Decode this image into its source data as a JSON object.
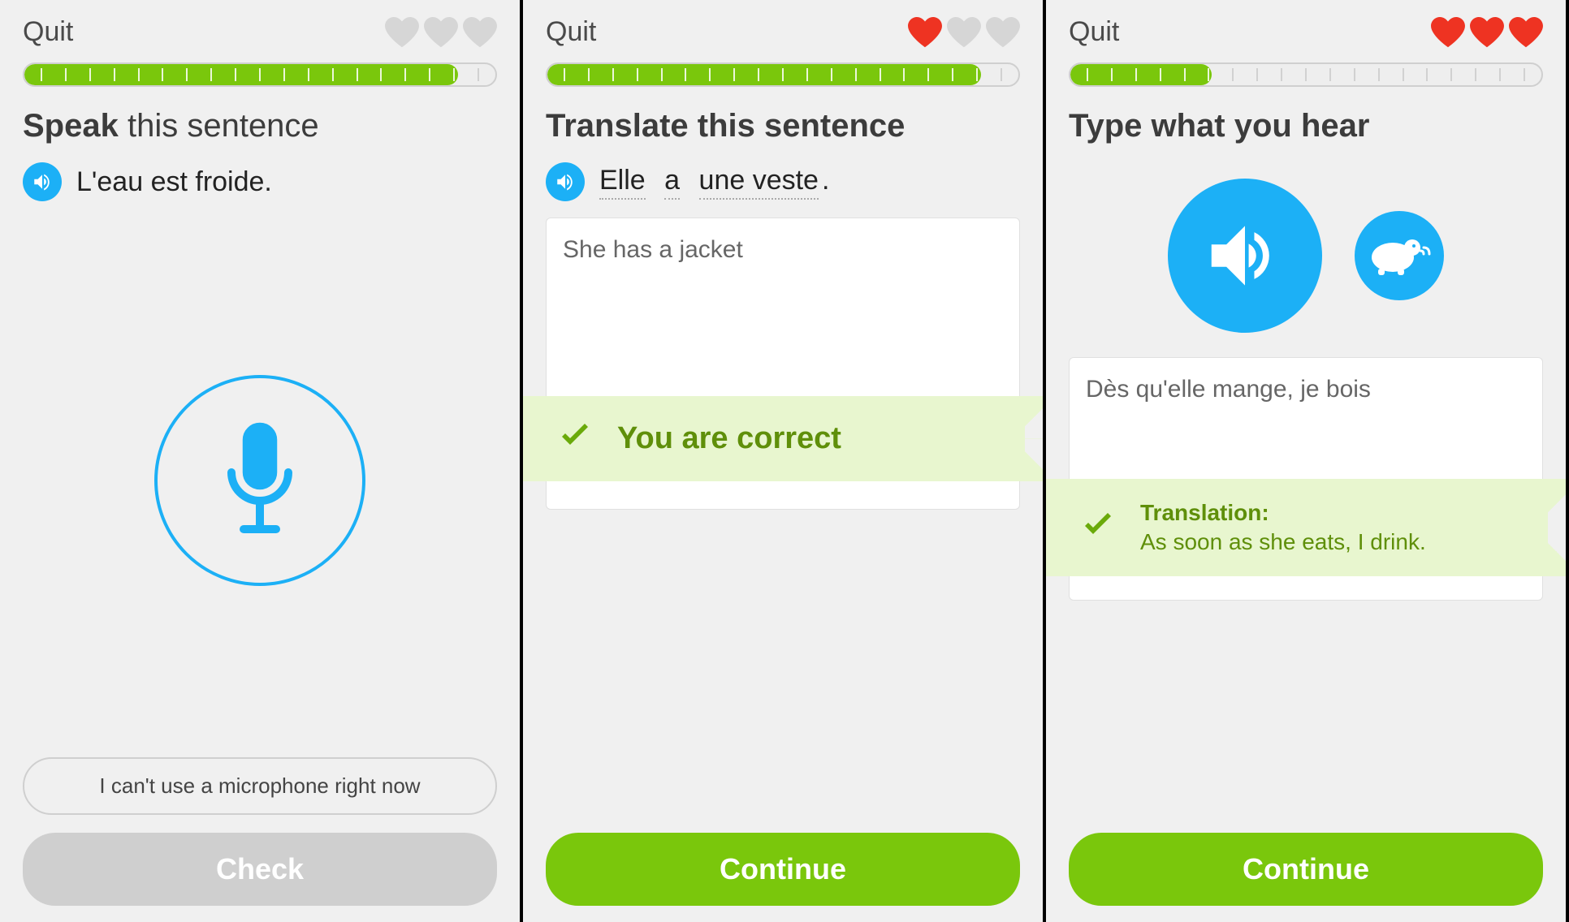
{
  "colors": {
    "brand_blue": "#1cb0f6",
    "brand_green": "#7ac70c",
    "heart_red": "#ee3322",
    "heart_grey": "#d6d6d6",
    "feedback_bg": "#e8f6cf",
    "feedback_text": "#5f8f0a"
  },
  "screens": [
    {
      "quit_label": "Quit",
      "hearts": [
        "empty",
        "empty",
        "empty"
      ],
      "progress_pct": 92,
      "prompt_bold": "Speak",
      "prompt_rest": " this sentence",
      "sentence_plain": "L'eau est froide.",
      "secondary_button": "I can't use a microphone right now",
      "primary_button": "Check",
      "primary_state": "disabled"
    },
    {
      "quit_label": "Quit",
      "hearts": [
        "full",
        "empty",
        "empty"
      ],
      "progress_pct": 92,
      "prompt_bold": "Translate this sentence",
      "prompt_rest": "",
      "sentence_tokens": [
        "Elle",
        "a",
        "une veste"
      ],
      "sentence_trailing": ".",
      "answer_text": "She has a jacket",
      "feedback_text": "You are correct",
      "primary_button": "Continue",
      "primary_state": "green"
    },
    {
      "quit_label": "Quit",
      "hearts": [
        "full",
        "full",
        "full"
      ],
      "progress_pct": 30,
      "prompt_bold": "Type what you hear",
      "prompt_rest": "",
      "answer_text": "Dès qu'elle mange, je bois",
      "feedback_title": "Translation:",
      "feedback_body": "As soon as she eats, I drink.",
      "primary_button": "Continue",
      "primary_state": "green"
    }
  ]
}
